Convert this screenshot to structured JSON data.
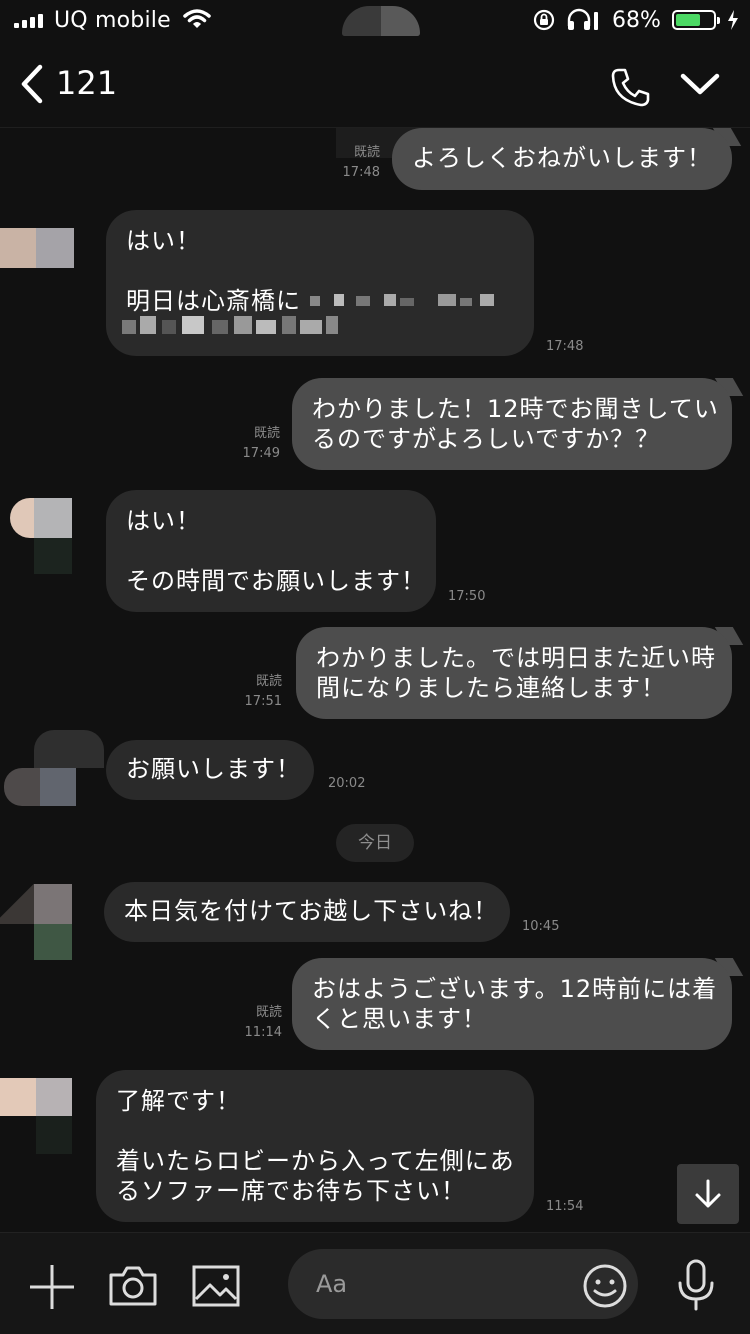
{
  "status_bar": {
    "carrier": "UQ mobile",
    "battery_percent": "68%",
    "battery_level": 0.68,
    "icons": [
      "signal-icon",
      "wifi-icon",
      "rotation-lock-icon",
      "headphones-icon",
      "battery-icon",
      "charging-icon"
    ]
  },
  "header": {
    "title": "121",
    "icons": [
      "back-chevron-icon",
      "phone-icon",
      "chevron-down-icon"
    ]
  },
  "messages": [
    {
      "dir": "out",
      "lines": [
        "よろしくおねがいします！"
      ],
      "read": "既読",
      "time": "17:48"
    },
    {
      "dir": "in",
      "lines": [
        "はい！",
        "",
        "明日は心斎橋に"
      ],
      "time": "17:48"
    },
    {
      "dir": "out",
      "lines": [
        "わかりました！12時でお聞きしてい",
        "るのですがよろしいですか？？"
      ],
      "read": "既読",
      "time": "17:49"
    },
    {
      "dir": "in",
      "lines": [
        "はい！",
        "",
        "その時間でお願いします！"
      ],
      "time": "17:50"
    },
    {
      "dir": "out",
      "lines": [
        "わかりました。では明日また近い時",
        "間になりましたら連絡します！"
      ],
      "read": "既読",
      "time": "17:51"
    },
    {
      "dir": "in",
      "lines": [
        "お願いします！"
      ],
      "time": "20:02"
    },
    {
      "dir": "in",
      "lines": [
        "本日気を付けてお越し下さいね！"
      ],
      "time": "10:45"
    },
    {
      "dir": "out",
      "lines": [
        "おはようございます。12時前には着",
        "くと思います！"
      ],
      "read": "既読",
      "time": "11:14"
    },
    {
      "dir": "in",
      "lines": [
        "了解です！",
        "",
        "着いたらロビーから入って左側にあ",
        "るソファー席でお待ち下さい！"
      ],
      "time": "11:54"
    }
  ],
  "date_separator": "今日",
  "input": {
    "placeholder": "Aa"
  },
  "colors": {
    "background": "#111111",
    "incoming_bubble": "#2a2a2a",
    "outgoing_bubble": "#4d4d4d",
    "battery_fill": "#4cd964"
  }
}
